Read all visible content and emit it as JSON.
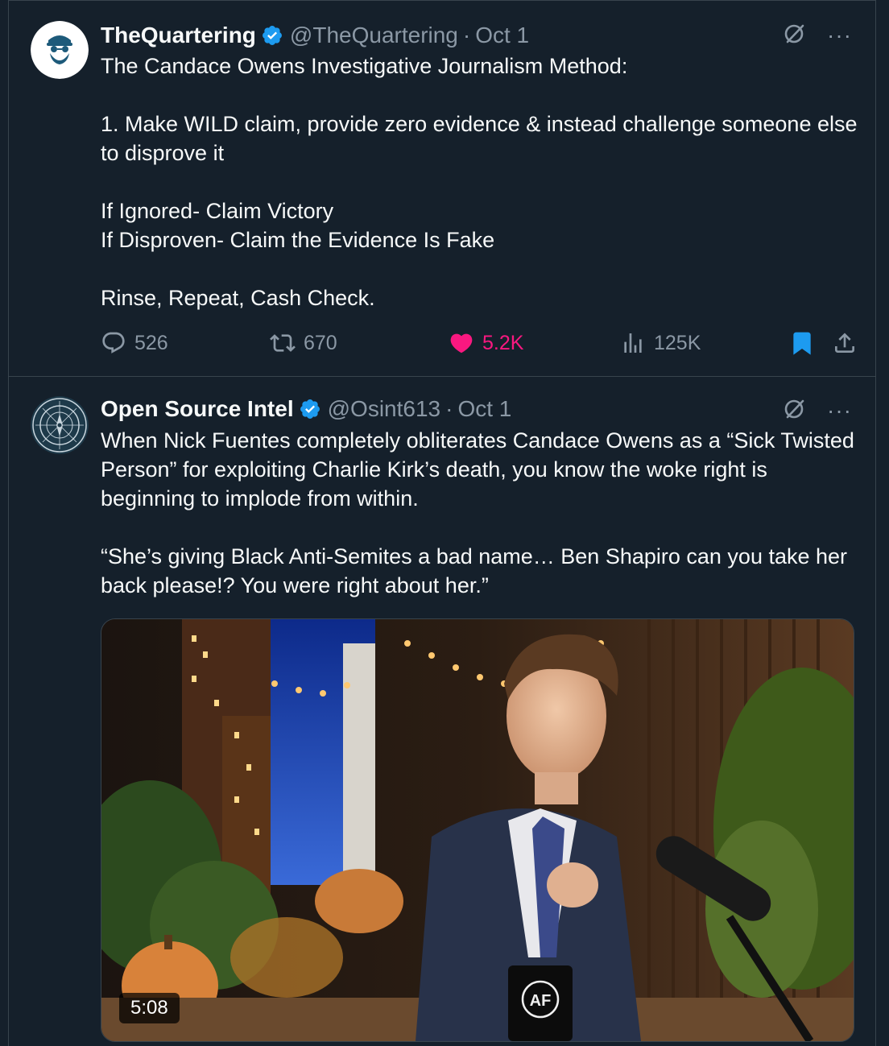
{
  "tweets": [
    {
      "author_name": "TheQuartering",
      "handle": "@TheQuartering",
      "separator": "·",
      "date": "Oct 1",
      "more": "···",
      "text_lines": [
        "The Candace Owens Investigative Journalism Method:",
        "",
        "1. Make WILD claim, provide zero evidence & instead challenge someone else to disprove it",
        "",
        "If Ignored- Claim Victory",
        "If Disproven- Claim the Evidence Is Fake",
        "",
        "Rinse, Repeat, Cash Check."
      ],
      "stats": {
        "replies": "526",
        "reposts": "670",
        "likes": "5.2K",
        "views": "125K"
      },
      "liked": true,
      "bookmarked": true
    },
    {
      "author_name": "Open Source Intel",
      "handle": "@Osint613",
      "separator": "·",
      "date": "Oct 1",
      "more": "···",
      "text_lines": [
        "When Nick Fuentes completely obliterates Candace Owens as a “Sick Twisted Person” for exploiting Charlie Kirk’s death, you know the woke right is beginning to implode from within.",
        "",
        "“She’s giving Black Anti-Semites a bad name… Ben Shapiro can you take her back please!? You were right about her.”"
      ],
      "media": {
        "type": "video",
        "duration": "5:08",
        "mug_logo": "AF"
      }
    }
  ],
  "colors": {
    "background": "#15202b",
    "accent_blue": "#1d9bf0",
    "like_pink": "#f91880",
    "muted_text": "#8b98a5",
    "border": "#38444d"
  },
  "icons": {
    "verified": "verified-badge-icon",
    "grok": "grok-icon",
    "reply": "reply-icon",
    "repost": "repost-icon",
    "like": "heart-icon",
    "views": "views-icon",
    "bookmark": "bookmark-icon",
    "share": "share-icon"
  }
}
